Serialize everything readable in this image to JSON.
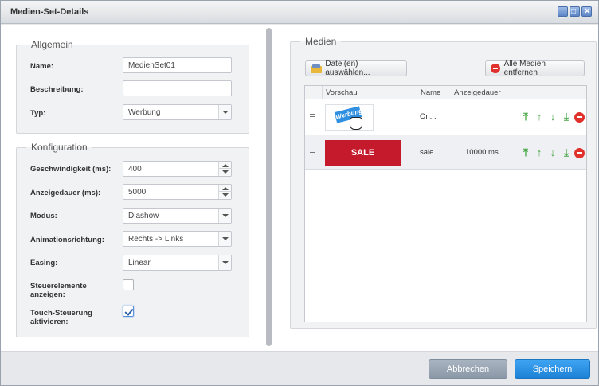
{
  "window": {
    "title": "Medien-Set-Details"
  },
  "allgemein": {
    "legend": "Allgemein",
    "name_label": "Name:",
    "name_value": "MedienSet01",
    "beschreibung_label": "Beschreibung:",
    "beschreibung_value": "",
    "typ_label": "Typ:",
    "typ_value": "Werbung"
  },
  "konfiguration": {
    "legend": "Konfiguration",
    "geschwindigkeit_label": "Geschwindigkeit (ms):",
    "geschwindigkeit_value": "400",
    "anzeigedauer_label": "Anzeigedauer (ms):",
    "anzeigedauer_value": "5000",
    "modus_label": "Modus:",
    "modus_value": "Diashow",
    "animationsrichtung_label": "Animationsrichtung:",
    "animationsrichtung_value": "Rechts -> Links",
    "easing_label": "Easing:",
    "easing_value": "Linear",
    "steuerelemente_label_1": "Steuerelemente",
    "steuerelemente_label_2": "anzeigen:",
    "steuerelemente_checked": false,
    "touch_label_1": "Touch-Steuerung",
    "touch_label_2": "aktivieren:",
    "touch_checked": true
  },
  "medien": {
    "legend": "Medien",
    "select_files_label": "Datei(en) auswählen...",
    "remove_all_label": "Alle Medien entfernen",
    "columns": [
      "Vorschau",
      "Name",
      "Anzeigedauer"
    ],
    "rows": [
      {
        "thumb_text": "Werbung",
        "name": "On...",
        "duration": ""
      },
      {
        "thumb_text": "SALE",
        "name": "sale",
        "duration": "10000 ms"
      }
    ]
  },
  "footer": {
    "cancel_label": "Abbrechen",
    "save_label": "Speichern"
  },
  "colors": {
    "accent": "#1d82d6",
    "arrow_green": "#45a543",
    "delete_red": "#e0312d",
    "sale_red": "#c41a2c"
  }
}
